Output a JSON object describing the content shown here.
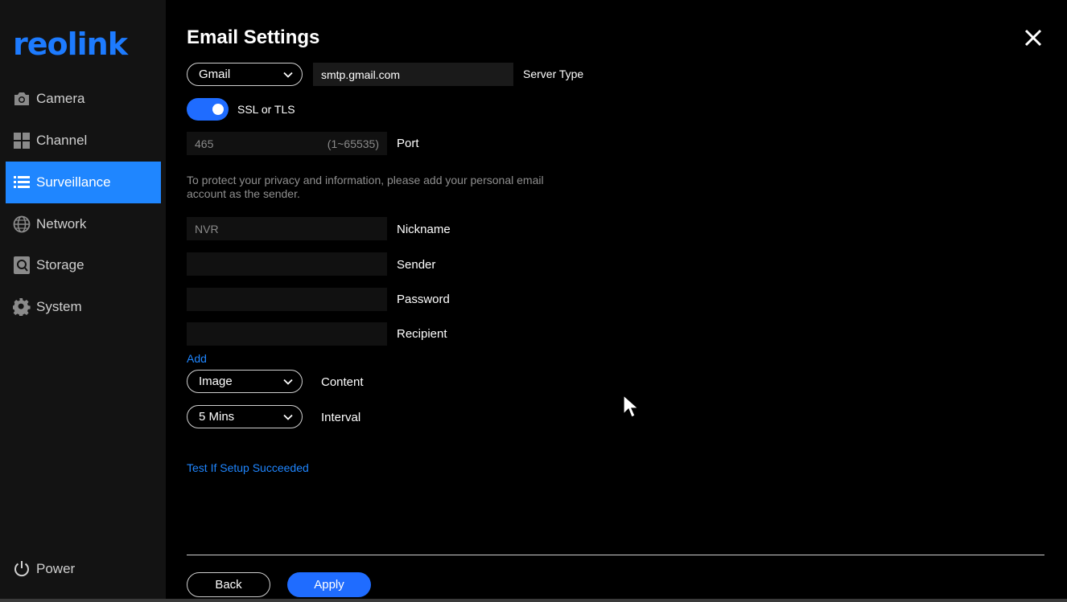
{
  "brand": {
    "logo_text": "reolink",
    "accent": "#1f86ff"
  },
  "sidebar": {
    "items": [
      {
        "label": "Camera",
        "icon": "camera-icon",
        "active": false
      },
      {
        "label": "Channel",
        "icon": "channel-grid-icon",
        "active": false
      },
      {
        "label": "Surveillance",
        "icon": "list-icon",
        "active": true
      },
      {
        "label": "Network",
        "icon": "globe-icon",
        "active": false
      },
      {
        "label": "Storage",
        "icon": "storage-icon",
        "active": false
      },
      {
        "label": "System",
        "icon": "gear-icon",
        "active": false
      }
    ],
    "power_label": "Power"
  },
  "page": {
    "title": "Email Settings"
  },
  "form": {
    "server_type": {
      "selected": "Gmail",
      "server": "smtp.gmail.com",
      "label": "Server Type"
    },
    "ssl": {
      "label": "SSL or TLS",
      "enabled": true
    },
    "port": {
      "value": "465",
      "range": "(1~65535)",
      "label": "Port"
    },
    "note": "To protect your privacy and information, please add your personal email account as the sender.",
    "nickname": {
      "value": "NVR",
      "label": "Nickname"
    },
    "sender": {
      "value": "",
      "label": "Sender"
    },
    "password": {
      "value": "",
      "label": "Password"
    },
    "recipient": {
      "value": "",
      "label": "Recipient"
    },
    "add_link": "Add",
    "content": {
      "selected": "Image",
      "label": "Content"
    },
    "interval": {
      "selected": "5 Mins",
      "label": "Interval"
    },
    "test_link": "Test If Setup Succeeded"
  },
  "footer": {
    "back_label": "Back",
    "apply_label": "Apply"
  }
}
